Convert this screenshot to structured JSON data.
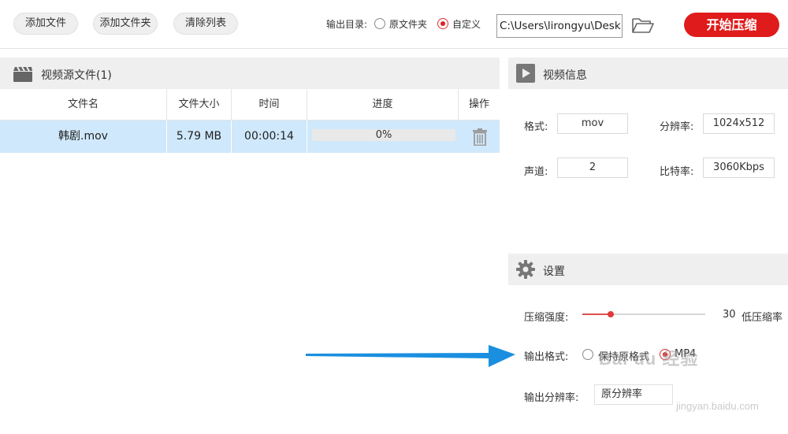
{
  "toolbar": {
    "add_file": "添加文件",
    "add_folder": "添加文件夹",
    "clear_list": "清除列表",
    "output_dir_label": "输出目录:",
    "option_original": "原文件夹",
    "option_custom": "自定义",
    "selected_option": "自定义",
    "output_path": "C:\\Users\\lirongyu\\Desk",
    "start_button": "开始压缩"
  },
  "source": {
    "title": "视频源文件(1)",
    "columns": [
      "文件名",
      "文件大小",
      "时间",
      "进度",
      "操作"
    ],
    "rows": [
      {
        "name": "韩剧.mov",
        "size": "5.79 MB",
        "duration": "00:00:14",
        "progress": "0%",
        "progress_value": 0
      }
    ]
  },
  "video_info": {
    "title": "视频信息",
    "format_label": "格式:",
    "format_value": "mov",
    "resolution_label": "分辨率:",
    "resolution_value": "1024x512",
    "channels_label": "声道:",
    "channels_value": "2",
    "bitrate_label": "比特率:",
    "bitrate_value": "3060Kbps"
  },
  "settings": {
    "title": "设置",
    "strength_label": "压缩强度:",
    "strength_value": "30",
    "strength_hint": "低压缩率",
    "strength_fraction": 0.23,
    "output_format_label": "输出格式:",
    "format_keep": "保持原格式",
    "format_mp4": "MP4",
    "selected_format": "MP4",
    "output_resolution_label": "输出分辨率:",
    "output_resolution_value": "原分辨率"
  },
  "watermark": {
    "logo": "Bai du 经验",
    "url": "jingyan.baidu.com"
  },
  "colors": {
    "accent": "#e01b1b",
    "selected_row": "#cfe8fb",
    "arrow": "#1a8fe0"
  }
}
